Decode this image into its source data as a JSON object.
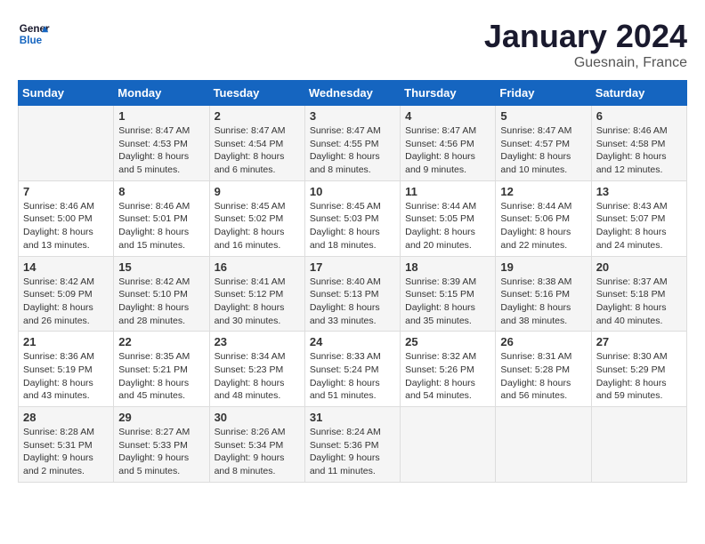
{
  "header": {
    "logo_line1": "General",
    "logo_line2": "Blue",
    "month": "January 2024",
    "location": "Guesnain, France"
  },
  "days_of_week": [
    "Sunday",
    "Monday",
    "Tuesday",
    "Wednesday",
    "Thursday",
    "Friday",
    "Saturday"
  ],
  "weeks": [
    [
      {
        "day": "",
        "info": ""
      },
      {
        "day": "1",
        "info": "Sunrise: 8:47 AM\nSunset: 4:53 PM\nDaylight: 8 hours\nand 5 minutes."
      },
      {
        "day": "2",
        "info": "Sunrise: 8:47 AM\nSunset: 4:54 PM\nDaylight: 8 hours\nand 6 minutes."
      },
      {
        "day": "3",
        "info": "Sunrise: 8:47 AM\nSunset: 4:55 PM\nDaylight: 8 hours\nand 8 minutes."
      },
      {
        "day": "4",
        "info": "Sunrise: 8:47 AM\nSunset: 4:56 PM\nDaylight: 8 hours\nand 9 minutes."
      },
      {
        "day": "5",
        "info": "Sunrise: 8:47 AM\nSunset: 4:57 PM\nDaylight: 8 hours\nand 10 minutes."
      },
      {
        "day": "6",
        "info": "Sunrise: 8:46 AM\nSunset: 4:58 PM\nDaylight: 8 hours\nand 12 minutes."
      }
    ],
    [
      {
        "day": "7",
        "info": "Sunrise: 8:46 AM\nSunset: 5:00 PM\nDaylight: 8 hours\nand 13 minutes."
      },
      {
        "day": "8",
        "info": "Sunrise: 8:46 AM\nSunset: 5:01 PM\nDaylight: 8 hours\nand 15 minutes."
      },
      {
        "day": "9",
        "info": "Sunrise: 8:45 AM\nSunset: 5:02 PM\nDaylight: 8 hours\nand 16 minutes."
      },
      {
        "day": "10",
        "info": "Sunrise: 8:45 AM\nSunset: 5:03 PM\nDaylight: 8 hours\nand 18 minutes."
      },
      {
        "day": "11",
        "info": "Sunrise: 8:44 AM\nSunset: 5:05 PM\nDaylight: 8 hours\nand 20 minutes."
      },
      {
        "day": "12",
        "info": "Sunrise: 8:44 AM\nSunset: 5:06 PM\nDaylight: 8 hours\nand 22 minutes."
      },
      {
        "day": "13",
        "info": "Sunrise: 8:43 AM\nSunset: 5:07 PM\nDaylight: 8 hours\nand 24 minutes."
      }
    ],
    [
      {
        "day": "14",
        "info": "Sunrise: 8:42 AM\nSunset: 5:09 PM\nDaylight: 8 hours\nand 26 minutes."
      },
      {
        "day": "15",
        "info": "Sunrise: 8:42 AM\nSunset: 5:10 PM\nDaylight: 8 hours\nand 28 minutes."
      },
      {
        "day": "16",
        "info": "Sunrise: 8:41 AM\nSunset: 5:12 PM\nDaylight: 8 hours\nand 30 minutes."
      },
      {
        "day": "17",
        "info": "Sunrise: 8:40 AM\nSunset: 5:13 PM\nDaylight: 8 hours\nand 33 minutes."
      },
      {
        "day": "18",
        "info": "Sunrise: 8:39 AM\nSunset: 5:15 PM\nDaylight: 8 hours\nand 35 minutes."
      },
      {
        "day": "19",
        "info": "Sunrise: 8:38 AM\nSunset: 5:16 PM\nDaylight: 8 hours\nand 38 minutes."
      },
      {
        "day": "20",
        "info": "Sunrise: 8:37 AM\nSunset: 5:18 PM\nDaylight: 8 hours\nand 40 minutes."
      }
    ],
    [
      {
        "day": "21",
        "info": "Sunrise: 8:36 AM\nSunset: 5:19 PM\nDaylight: 8 hours\nand 43 minutes."
      },
      {
        "day": "22",
        "info": "Sunrise: 8:35 AM\nSunset: 5:21 PM\nDaylight: 8 hours\nand 45 minutes."
      },
      {
        "day": "23",
        "info": "Sunrise: 8:34 AM\nSunset: 5:23 PM\nDaylight: 8 hours\nand 48 minutes."
      },
      {
        "day": "24",
        "info": "Sunrise: 8:33 AM\nSunset: 5:24 PM\nDaylight: 8 hours\nand 51 minutes."
      },
      {
        "day": "25",
        "info": "Sunrise: 8:32 AM\nSunset: 5:26 PM\nDaylight: 8 hours\nand 54 minutes."
      },
      {
        "day": "26",
        "info": "Sunrise: 8:31 AM\nSunset: 5:28 PM\nDaylight: 8 hours\nand 56 minutes."
      },
      {
        "day": "27",
        "info": "Sunrise: 8:30 AM\nSunset: 5:29 PM\nDaylight: 8 hours\nand 59 minutes."
      }
    ],
    [
      {
        "day": "28",
        "info": "Sunrise: 8:28 AM\nSunset: 5:31 PM\nDaylight: 9 hours\nand 2 minutes."
      },
      {
        "day": "29",
        "info": "Sunrise: 8:27 AM\nSunset: 5:33 PM\nDaylight: 9 hours\nand 5 minutes."
      },
      {
        "day": "30",
        "info": "Sunrise: 8:26 AM\nSunset: 5:34 PM\nDaylight: 9 hours\nand 8 minutes."
      },
      {
        "day": "31",
        "info": "Sunrise: 8:24 AM\nSunset: 5:36 PM\nDaylight: 9 hours\nand 11 minutes."
      },
      {
        "day": "",
        "info": ""
      },
      {
        "day": "",
        "info": ""
      },
      {
        "day": "",
        "info": ""
      }
    ]
  ]
}
